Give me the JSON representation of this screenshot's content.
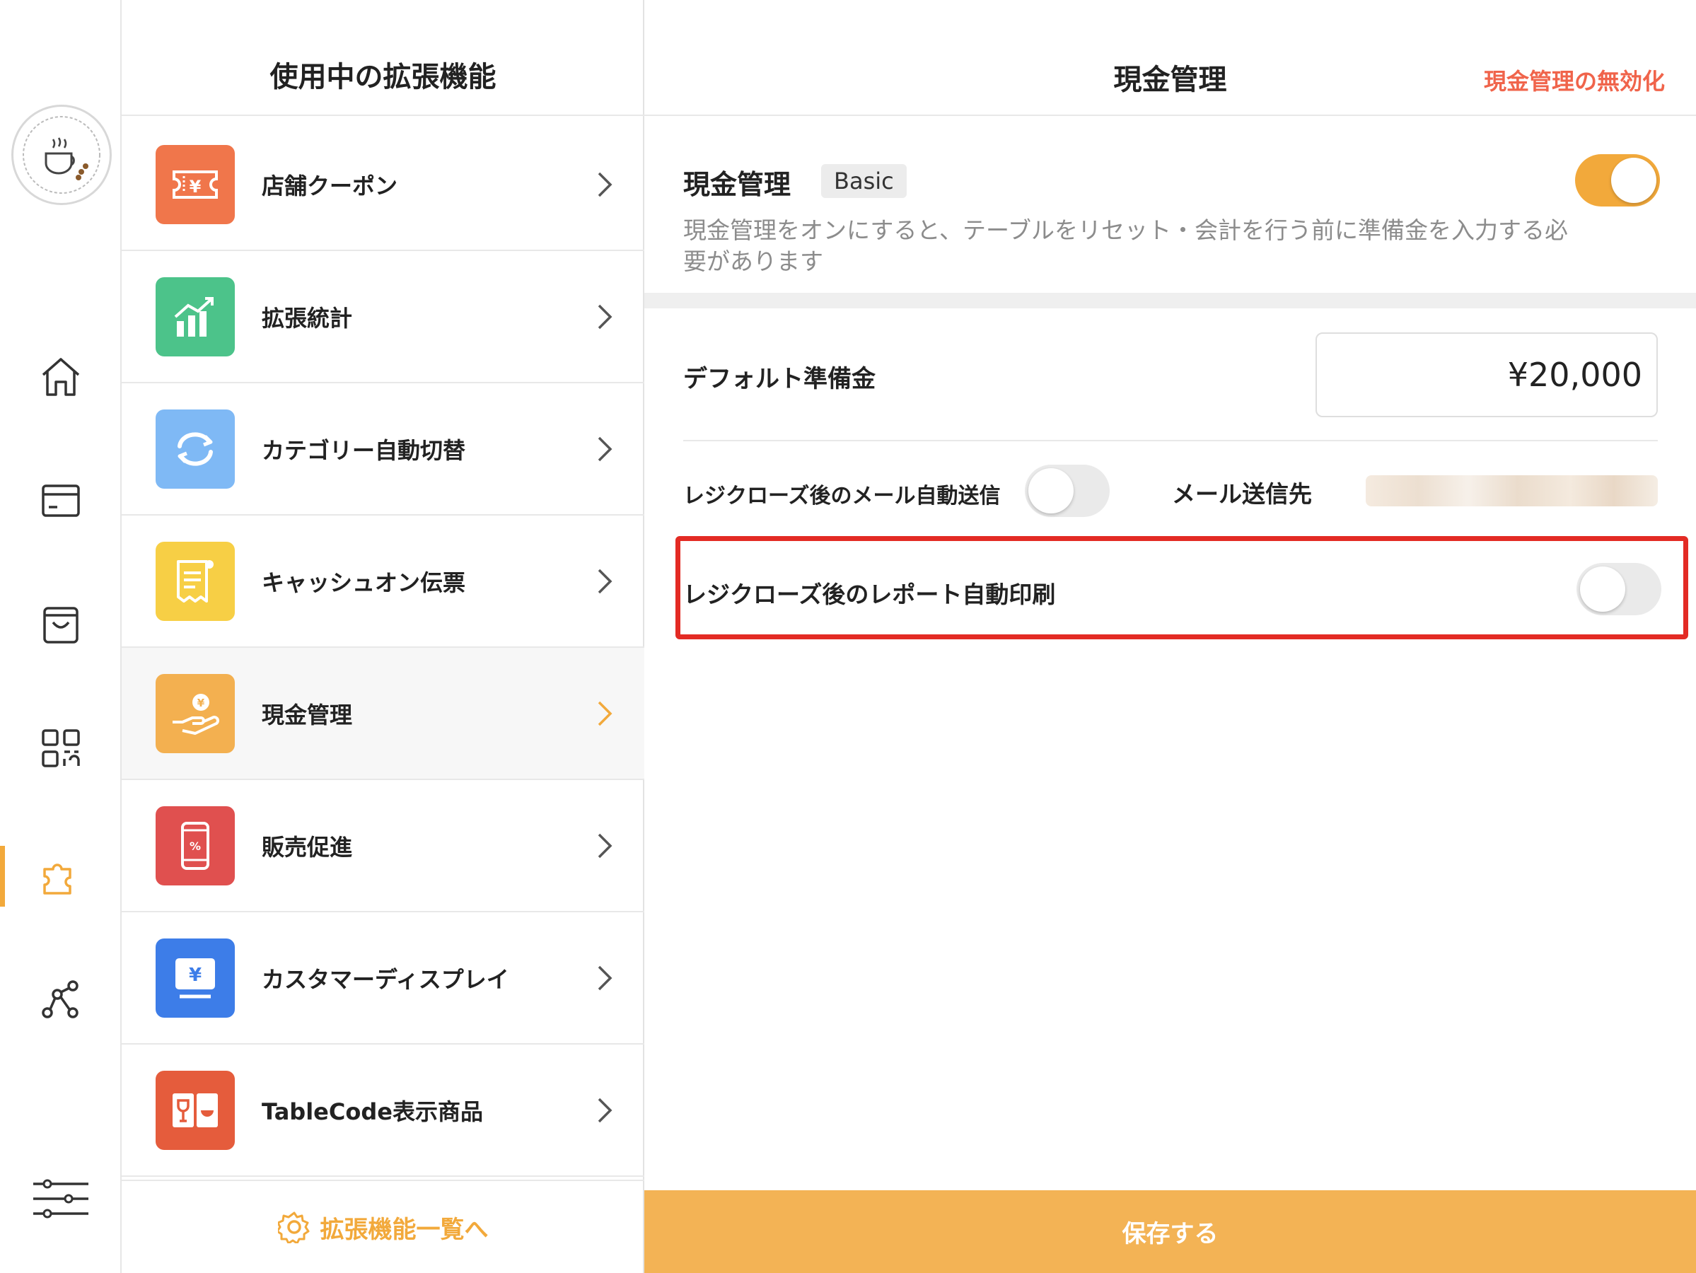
{
  "colors": {
    "accent": "#f2a93b",
    "danger": "#f0644b",
    "highlight": "#e32b24",
    "save_bar": "#f3b355"
  },
  "rail": {
    "items": [
      {
        "name": "logo",
        "icon": "cafe-logo"
      },
      {
        "name": "home",
        "icon": "home-icon"
      },
      {
        "name": "orders",
        "icon": "card-icon"
      },
      {
        "name": "shopping",
        "icon": "shopping-bag-icon"
      },
      {
        "name": "qr",
        "icon": "qr-code-icon"
      },
      {
        "name": "extensions",
        "icon": "puzzle-icon",
        "active": true
      },
      {
        "name": "network",
        "icon": "network-icon"
      },
      {
        "name": "settings",
        "icon": "sliders-icon"
      }
    ]
  },
  "extensions": {
    "title": "使用中の拡張機能",
    "items": [
      {
        "label": "店舗クーポン",
        "icon": "coupon-icon",
        "color": "#f0764b"
      },
      {
        "label": "拡張統計",
        "icon": "chart-icon",
        "color": "#4cc38a"
      },
      {
        "label": "カテゴリー自動切替",
        "icon": "refresh-icon",
        "color": "#7fb9f5"
      },
      {
        "label": "キャッシュオン伝票",
        "icon": "receipt-icon",
        "color": "#f7cf45"
      },
      {
        "label": "現金管理",
        "icon": "cash-hand-icon",
        "color": "#f3b050",
        "active": true
      },
      {
        "label": "販売促進",
        "icon": "phone-discount-icon",
        "color": "#e0504f"
      },
      {
        "label": "カスタマーディスプレイ",
        "icon": "display-yen-icon",
        "color": "#3d7de8"
      },
      {
        "label": "TableCode表示商品",
        "icon": "wine-bowl-icon",
        "color": "#e55c3c"
      }
    ],
    "footer_label": "拡張機能一覧へ"
  },
  "detail": {
    "title": "現金管理",
    "disable_label": "現金管理の無効化",
    "section_title": "現金管理",
    "badge": "Basic",
    "description": "現金管理をオンにすると、テーブルをリセット・会計を行う前に準備金を入力する必要があります",
    "cash_toggle_on": true,
    "default_reserve_label": "デフォルト準備金",
    "default_reserve_value": "¥20,000",
    "mail_auto_send_label": "レジクローズ後のメール自動送信",
    "mail_auto_send_on": false,
    "mail_destination_label": "メール送信先",
    "auto_print_label": "レジクローズ後のレポート自動印刷",
    "auto_print_on": false,
    "save_label": "保存する"
  }
}
